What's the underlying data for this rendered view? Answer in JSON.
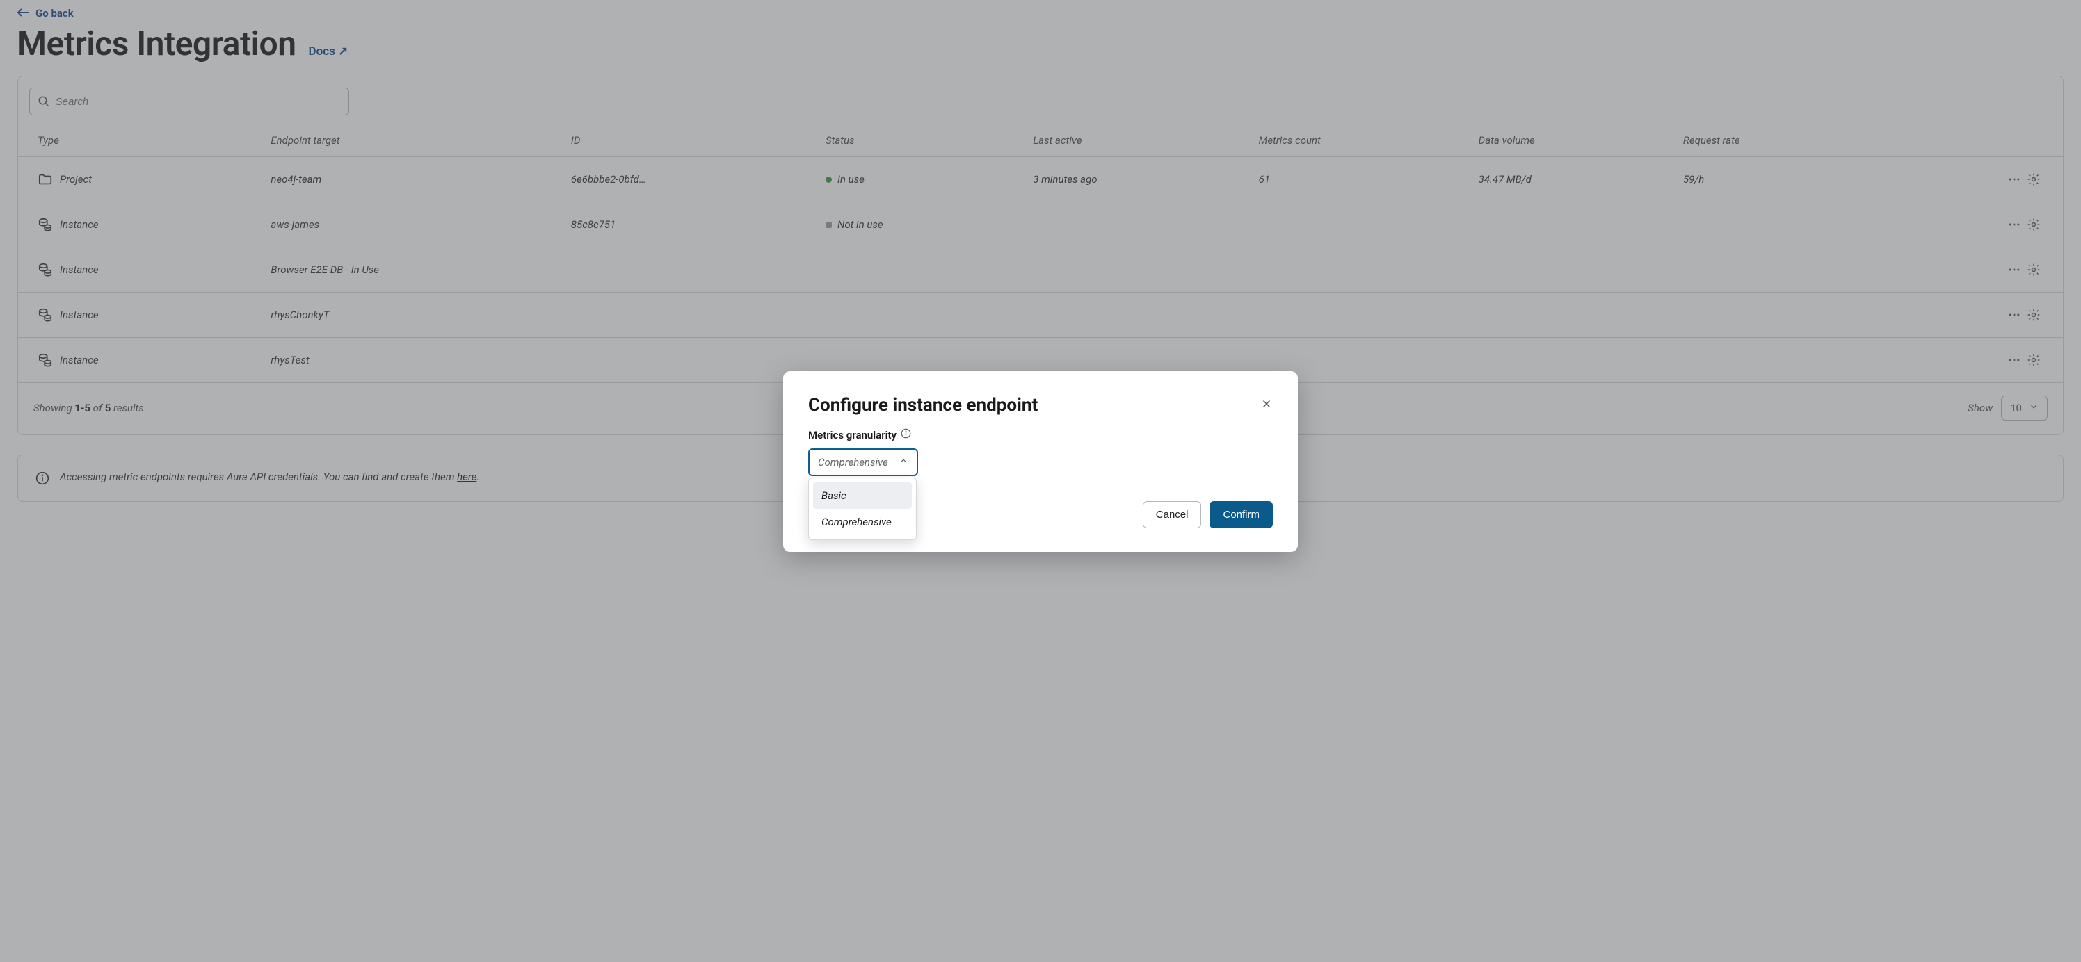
{
  "nav": {
    "go_back": "Go back",
    "page_title": "Metrics Integration",
    "docs_link": "Docs ↗"
  },
  "search": {
    "placeholder": "Search"
  },
  "columns": {
    "type": "Type",
    "endpoint": "Endpoint target",
    "id": "ID",
    "status": "Status",
    "last_active": "Last active",
    "metrics_count": "Metrics count",
    "data_volume": "Data volume",
    "request_rate": "Request rate"
  },
  "status_labels": {
    "in_use": "In use",
    "not_in_use": "Not in use"
  },
  "rows": [
    {
      "type": "Project",
      "endpoint": "neo4j-team",
      "id": "6e6bbbe2-0bfd…",
      "status": "in_use",
      "last_active": "3 minutes ago",
      "metrics_count": "61",
      "data_volume": "34.47 MB/d",
      "request_rate": "59/h"
    },
    {
      "type": "Instance",
      "endpoint": "aws-james",
      "id": "85c8c751",
      "status": "not_in_use",
      "last_active": "",
      "metrics_count": "",
      "data_volume": "",
      "request_rate": ""
    },
    {
      "type": "Instance",
      "endpoint": "Browser E2E DB - In Use",
      "id": "",
      "status": "",
      "last_active": "",
      "metrics_count": "",
      "data_volume": "",
      "request_rate": ""
    },
    {
      "type": "Instance",
      "endpoint": "rhysChonkyT",
      "id": "",
      "status": "",
      "last_active": "",
      "metrics_count": "",
      "data_volume": "",
      "request_rate": ""
    },
    {
      "type": "Instance",
      "endpoint": "rhysTest",
      "id": "",
      "status": "",
      "last_active": "",
      "metrics_count": "",
      "data_volume": "",
      "request_rate": ""
    }
  ],
  "footer": {
    "showing_prefix": "Showing ",
    "range": "1-5",
    "of": " of ",
    "total": "5",
    "suffix": " results",
    "show_label": "Show",
    "show_value": "10"
  },
  "banner": {
    "text_before": "Accessing metric endpoints requires Aura API credentials. You can find and create them ",
    "link": "here",
    "text_after": "."
  },
  "dialog": {
    "title": "Configure instance endpoint",
    "field_label": "Metrics granularity",
    "select_value": "Comprehensive",
    "options": {
      "basic": "Basic",
      "comprehensive": "Comprehensive"
    },
    "cancel": "Cancel",
    "confirm": "Confirm"
  }
}
